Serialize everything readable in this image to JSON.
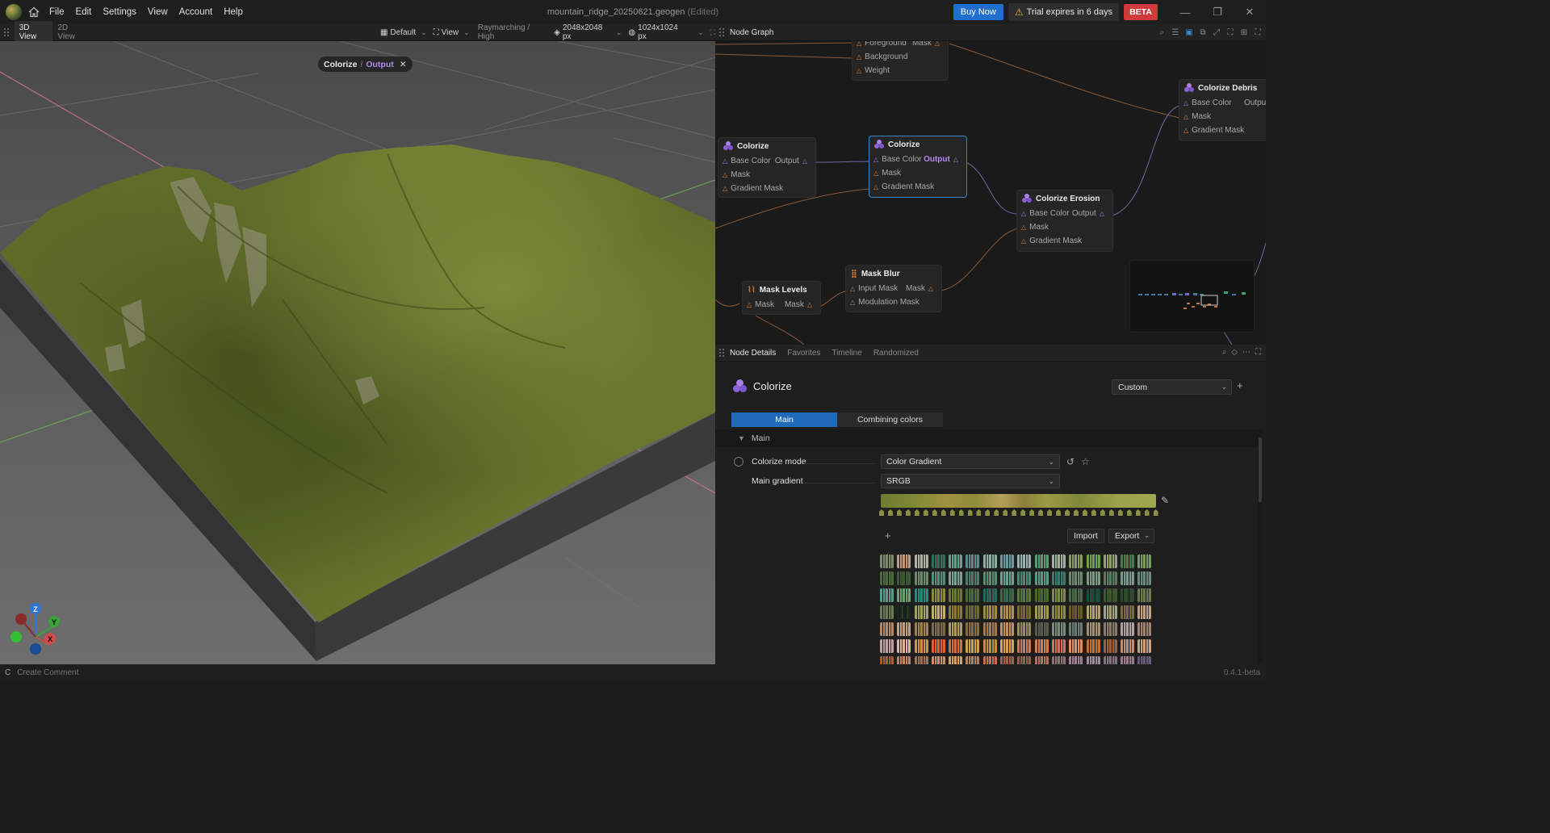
{
  "window": {
    "menus": [
      "File",
      "Edit",
      "Settings",
      "View",
      "Account",
      "Help"
    ],
    "title": "mountain_ridge_20250621.geogen",
    "edited": "(Edited)",
    "buy_label": "Buy Now",
    "trial_label": "Trial expires in 6 days",
    "beta_label": "BETA"
  },
  "viewport_toolbar": {
    "tabs": [
      "3D View",
      "2D View"
    ],
    "camera": "Default",
    "view": "View",
    "render_mode": "Raymarching / High",
    "resolution": "2048x2048 px",
    "tile_resolution": "1024x1024 px"
  },
  "viewport": {
    "output_node": "Colorize",
    "output_sep": "/",
    "output_port": "Output",
    "axes": {
      "z": "Z",
      "y": "Y",
      "x": "X"
    }
  },
  "node_graph": {
    "panel_title": "Node Graph",
    "nodes": {
      "blend": {
        "ports": [
          "Foreground",
          "Background",
          "Weight"
        ],
        "out": "Mask"
      },
      "colorize_a": {
        "title": "Colorize",
        "ports": [
          "Base Color",
          "Mask",
          "Gradient Mask"
        ],
        "out": "Output"
      },
      "colorize_b": {
        "title": "Colorize",
        "ports": [
          "Base Color",
          "Mask",
          "Gradient Mask"
        ],
        "out": "Output"
      },
      "colorize_erosion": {
        "title": "Colorize Erosion",
        "ports": [
          "Base Color",
          "Mask",
          "Gradient Mask"
        ],
        "out": "Output"
      },
      "colorize_debris": {
        "title": "Colorize Debris",
        "ports": [
          "Base Color",
          "Mask",
          "Gradient Mask"
        ],
        "out": "Output"
      },
      "mask_levels": {
        "title": "Mask Levels",
        "ports": [
          "Mask"
        ],
        "out": "Mask"
      },
      "mask_blur": {
        "title": "Mask Blur",
        "ports": [
          "Input Mask",
          "Modulation Mask"
        ],
        "out": "Mask"
      }
    }
  },
  "details": {
    "tabs": [
      "Node Details",
      "Favorites",
      "Timeline",
      "Randomized"
    ],
    "node_title": "Colorize",
    "preset": "Custom",
    "subtabs": [
      "Main",
      "Combining colors"
    ],
    "section": "Main",
    "params": [
      {
        "label": "Colorize mode",
        "value": "Color Gradient"
      },
      {
        "label": "Main gradient",
        "value": "SRGB"
      }
    ],
    "import_label": "Import",
    "export_label": "Export"
  },
  "status": {
    "key": "C",
    "hint": "Create Comment",
    "version": "0.4.1-beta"
  }
}
